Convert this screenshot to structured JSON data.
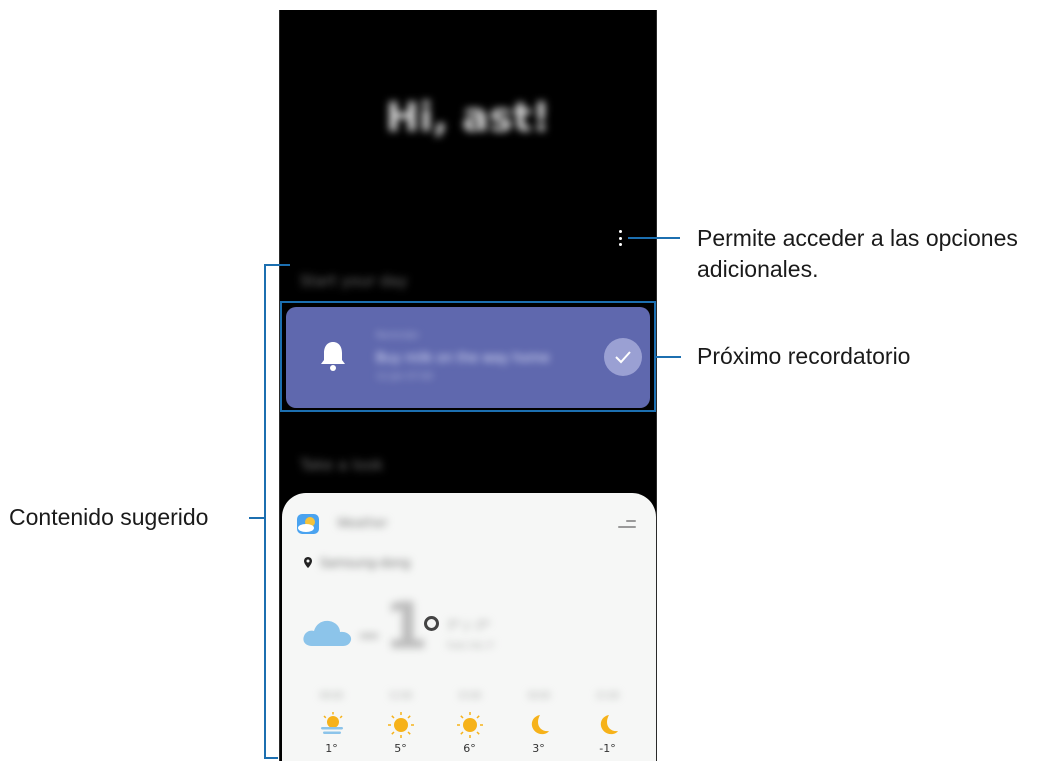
{
  "screen": {
    "greeting": "Hi, ast!",
    "more_options_icon": "more-vertical-icon",
    "section_start": "Start your day",
    "section_take_look": "Take a look"
  },
  "reminder": {
    "category": "Reminder",
    "title": "Buy milk on the way home",
    "date": "12 Jan 07:00",
    "card_color": "#5f68ae",
    "icons": [
      "bell-icon",
      "check-icon"
    ]
  },
  "weather": {
    "app_name": "Weather",
    "location": "Samsung-dong",
    "current_temp": "1",
    "high_low": "7° / -7°",
    "feels_like": "Feels like 3°",
    "forecast": [
      {
        "time": "09:00",
        "icon": "partly-cloudy-icon",
        "temp": "1°"
      },
      {
        "time": "12:00",
        "icon": "sun-icon",
        "temp": "5°"
      },
      {
        "time": "15:00",
        "icon": "sun-icon",
        "temp": "6°"
      },
      {
        "time": "18:00",
        "icon": "moon-icon",
        "temp": "3°"
      },
      {
        "time": "21:00",
        "icon": "moon-icon",
        "temp": "-1°"
      }
    ]
  },
  "callouts": {
    "more_options_line1": "Permite acceder a las opciones",
    "more_options_line2": "adicionales.",
    "next_reminder": "Próximo recordatorio",
    "suggested_content": "Contenido sugerido"
  },
  "colors": {
    "callout_line": "#1c6fb0",
    "sun": "#f6b21a",
    "cloud": "#8cc4ea"
  }
}
